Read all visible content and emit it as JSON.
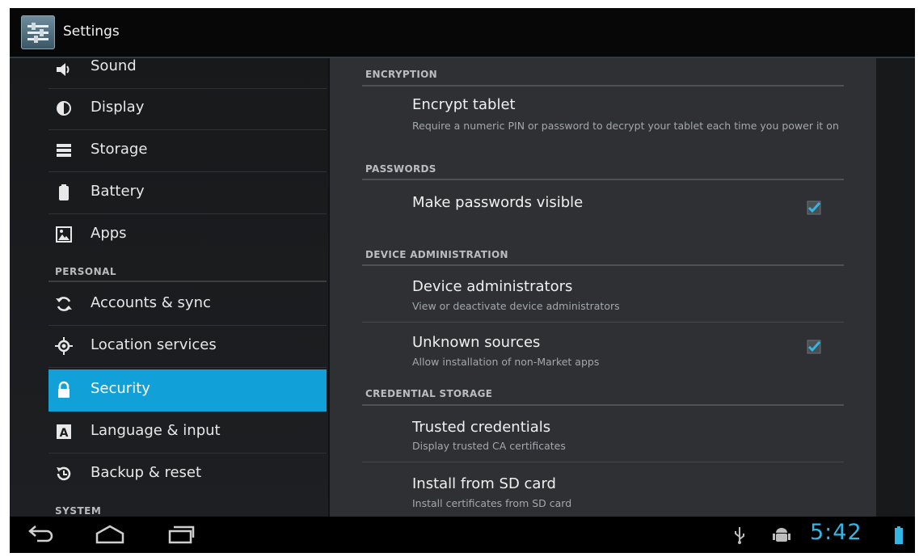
{
  "app": {
    "title": "Settings"
  },
  "sidebar": {
    "partial_item": "Sound",
    "items": [
      {
        "label": "Display",
        "icon": "brightness-icon"
      },
      {
        "label": "Storage",
        "icon": "storage-icon"
      },
      {
        "label": "Battery",
        "icon": "battery-icon"
      },
      {
        "label": "Apps",
        "icon": "apps-icon"
      },
      {
        "label": "Accounts & sync",
        "icon": "sync-icon"
      },
      {
        "label": "Location services",
        "icon": "location-icon"
      },
      {
        "label": "Security",
        "icon": "lock-icon",
        "selected": true
      },
      {
        "label": "Language & input",
        "icon": "language-icon"
      },
      {
        "label": "Backup & reset",
        "icon": "backup-icon"
      }
    ],
    "categories": {
      "personal": "PERSONAL",
      "system": "SYSTEM"
    }
  },
  "security": {
    "encryption": {
      "header": "ENCRYPTION",
      "encrypt_title": "Encrypt tablet",
      "encrypt_summary": "Require a numeric PIN or password to decrypt your tablet each time you power it on"
    },
    "passwords": {
      "header": "PASSWORDS",
      "visible_title": "Make passwords visible",
      "visible_checked": true
    },
    "device_admin": {
      "header": "DEVICE ADMINISTRATION",
      "admins_title": "Device administrators",
      "admins_summary": "View or deactivate device administrators",
      "unknown_title": "Unknown sources",
      "unknown_summary": "Allow installation of non-Market apps",
      "unknown_checked": true
    },
    "credential_storage": {
      "header": "CREDENTIAL STORAGE",
      "trusted_title": "Trusted credentials",
      "trusted_summary": "Display trusted CA certificates",
      "install_title": "Install from SD card",
      "install_summary": "Install certificates from SD card"
    }
  },
  "system_bar": {
    "time": "5:42",
    "icons": [
      "back-icon",
      "home-icon",
      "recent-apps-icon",
      "usb-icon",
      "android-debug-icon",
      "battery-status-icon"
    ],
    "accent": "#33b5e5"
  },
  "colors": {
    "selected": "#11a1d8",
    "accent": "#33b5e5"
  }
}
